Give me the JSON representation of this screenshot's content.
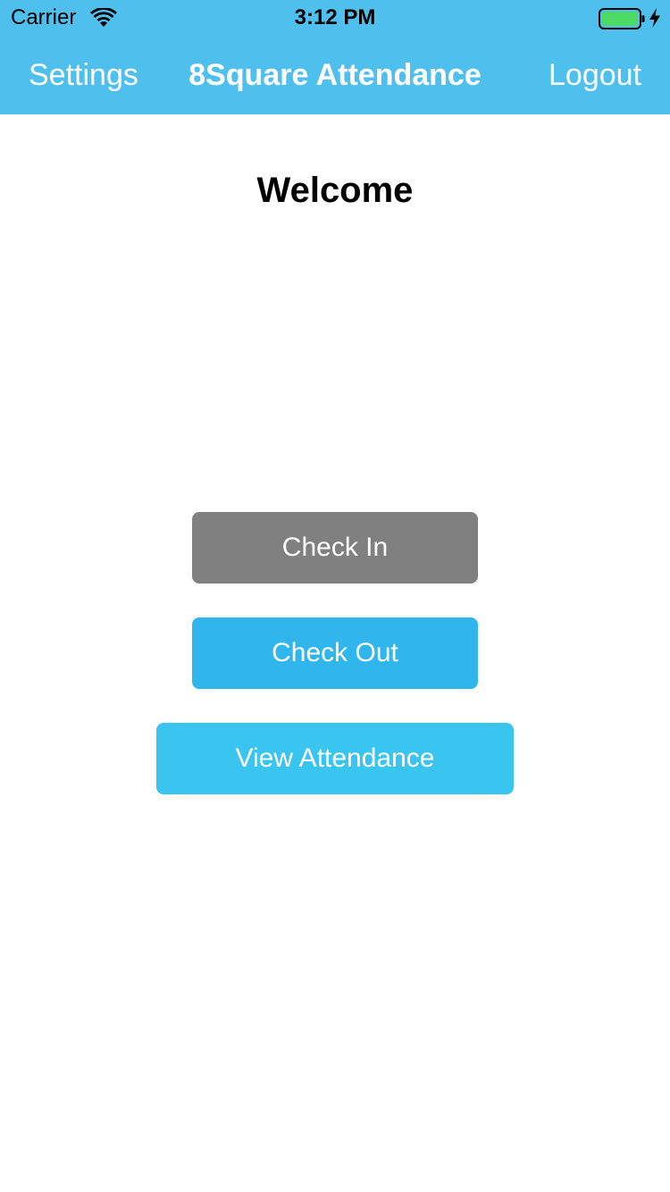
{
  "status_bar": {
    "carrier": "Carrier",
    "time": "3:12 PM",
    "icons": [
      "wifi-icon",
      "battery-icon",
      "charging-bolt-icon"
    ]
  },
  "nav": {
    "left_label": "Settings",
    "title": "8Square Attendance",
    "right_label": "Logout"
  },
  "main": {
    "heading": "Welcome",
    "buttons": {
      "check_in": "Check In",
      "check_out": "Check Out",
      "view_attendance": "View Attendance"
    }
  },
  "colors": {
    "header_bg": "#4fc0ee",
    "check_in_bg": "#808080",
    "check_out_bg": "#2fb6ec",
    "view_attendance_bg": "#3ac4f0",
    "battery_fill": "#4cd964"
  }
}
